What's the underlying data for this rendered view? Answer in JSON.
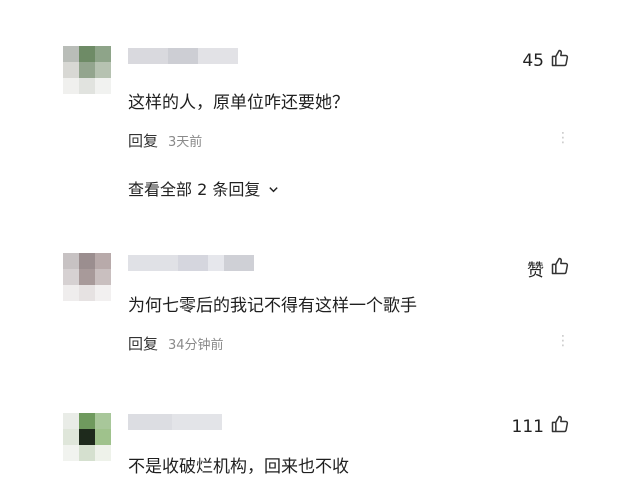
{
  "comments": [
    {
      "likes": "45",
      "text": "这样的人，原单位咋还要她？",
      "reply_label": "回复",
      "time": "3天前",
      "more": "⋮",
      "view_replies": "查看全部 2 条回复"
    },
    {
      "likes": "赞",
      "text": "为何七零后的我记不得有这样一个歌手",
      "reply_label": "回复",
      "time": "34分钟前",
      "more": "⋮"
    },
    {
      "likes": "111",
      "text": "不是收破烂机构，回来也不收"
    }
  ],
  "colors": {
    "like_icon": "#333333",
    "meta_gray": "#8a8a8a"
  },
  "icons": {
    "like": "thumbs-up-icon",
    "expand": "chevron-down-icon"
  }
}
